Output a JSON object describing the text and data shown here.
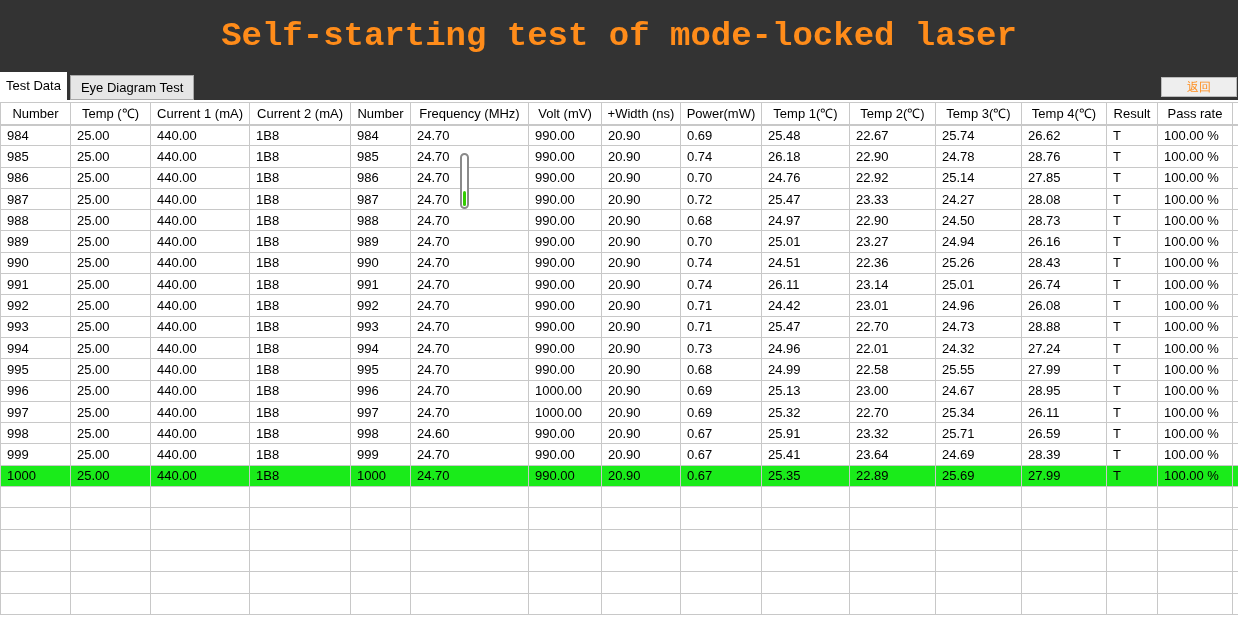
{
  "title": "Self-starting test of mode-locked laser",
  "tabs": [
    {
      "label": "Test Data",
      "selected": true
    },
    {
      "label": "Eye Diagram Test",
      "selected": false
    }
  ],
  "back_button": "返回",
  "table": {
    "columns": [
      "Number",
      "Temp (℃)",
      "Current 1 (mA)",
      "Current 2 (mA)",
      "Number",
      "Frequency (MHz)",
      "Volt (mV)",
      "+Width (ns)",
      "Power(mW)",
      "Temp 1(℃)",
      "Temp 2(℃)",
      "Temp 3(℃)",
      "Temp 4(℃)",
      "Result",
      "Pass rate"
    ],
    "rows": [
      {
        "selected": false,
        "cells": [
          "984",
          "25.00",
          "440.00",
          "1B8",
          "984",
          "24.70",
          "990.00",
          "20.90",
          "0.69",
          "25.48",
          "22.67",
          "25.74",
          "26.62",
          "T",
          "100.00 %"
        ]
      },
      {
        "selected": false,
        "cells": [
          "985",
          "25.00",
          "440.00",
          "1B8",
          "985",
          "24.70",
          "990.00",
          "20.90",
          "0.74",
          "26.18",
          "22.90",
          "24.78",
          "28.76",
          "T",
          "100.00 %"
        ]
      },
      {
        "selected": false,
        "cells": [
          "986",
          "25.00",
          "440.00",
          "1B8",
          "986",
          "24.70",
          "990.00",
          "20.90",
          "0.70",
          "24.76",
          "22.92",
          "25.14",
          "27.85",
          "T",
          "100.00 %"
        ]
      },
      {
        "selected": false,
        "cells": [
          "987",
          "25.00",
          "440.00",
          "1B8",
          "987",
          "24.70",
          "990.00",
          "20.90",
          "0.72",
          "25.47",
          "23.33",
          "24.27",
          "28.08",
          "T",
          "100.00 %"
        ]
      },
      {
        "selected": false,
        "cells": [
          "988",
          "25.00",
          "440.00",
          "1B8",
          "988",
          "24.70",
          "990.00",
          "20.90",
          "0.68",
          "24.97",
          "22.90",
          "24.50",
          "28.73",
          "T",
          "100.00 %"
        ]
      },
      {
        "selected": false,
        "cells": [
          "989",
          "25.00",
          "440.00",
          "1B8",
          "989",
          "24.70",
          "990.00",
          "20.90",
          "0.70",
          "25.01",
          "23.27",
          "24.94",
          "26.16",
          "T",
          "100.00 %"
        ]
      },
      {
        "selected": false,
        "cells": [
          "990",
          "25.00",
          "440.00",
          "1B8",
          "990",
          "24.70",
          "990.00",
          "20.90",
          "0.74",
          "24.51",
          "22.36",
          "25.26",
          "28.43",
          "T",
          "100.00 %"
        ]
      },
      {
        "selected": false,
        "cells": [
          "991",
          "25.00",
          "440.00",
          "1B8",
          "991",
          "24.70",
          "990.00",
          "20.90",
          "0.74",
          "26.11",
          "23.14",
          "25.01",
          "26.74",
          "T",
          "100.00 %"
        ]
      },
      {
        "selected": false,
        "cells": [
          "992",
          "25.00",
          "440.00",
          "1B8",
          "992",
          "24.70",
          "990.00",
          "20.90",
          "0.71",
          "24.42",
          "23.01",
          "24.96",
          "26.08",
          "T",
          "100.00 %"
        ]
      },
      {
        "selected": false,
        "cells": [
          "993",
          "25.00",
          "440.00",
          "1B8",
          "993",
          "24.70",
          "990.00",
          "20.90",
          "0.71",
          "25.47",
          "22.70",
          "24.73",
          "28.88",
          "T",
          "100.00 %"
        ]
      },
      {
        "selected": false,
        "cells": [
          "994",
          "25.00",
          "440.00",
          "1B8",
          "994",
          "24.70",
          "990.00",
          "20.90",
          "0.73",
          "24.96",
          "22.01",
          "24.32",
          "27.24",
          "T",
          "100.00 %"
        ]
      },
      {
        "selected": false,
        "cells": [
          "995",
          "25.00",
          "440.00",
          "1B8",
          "995",
          "24.70",
          "990.00",
          "20.90",
          "0.68",
          "24.99",
          "22.58",
          "25.55",
          "27.99",
          "T",
          "100.00 %"
        ]
      },
      {
        "selected": false,
        "cells": [
          "996",
          "25.00",
          "440.00",
          "1B8",
          "996",
          "24.70",
          "1000.00",
          "20.90",
          "0.69",
          "25.13",
          "23.00",
          "24.67",
          "28.95",
          "T",
          "100.00 %"
        ]
      },
      {
        "selected": false,
        "cells": [
          "997",
          "25.00",
          "440.00",
          "1B8",
          "997",
          "24.70",
          "1000.00",
          "20.90",
          "0.69",
          "25.32",
          "22.70",
          "25.34",
          "26.11",
          "T",
          "100.00 %"
        ]
      },
      {
        "selected": false,
        "cells": [
          "998",
          "25.00",
          "440.00",
          "1B8",
          "998",
          "24.60",
          "990.00",
          "20.90",
          "0.67",
          "25.91",
          "23.32",
          "25.71",
          "26.59",
          "T",
          "100.00 %"
        ]
      },
      {
        "selected": false,
        "cells": [
          "999",
          "25.00",
          "440.00",
          "1B8",
          "999",
          "24.70",
          "990.00",
          "20.90",
          "0.67",
          "25.41",
          "23.64",
          "24.69",
          "28.39",
          "T",
          "100.00 %"
        ]
      },
      {
        "selected": true,
        "cells": [
          "1000",
          "25.00",
          "440.00",
          "1B8",
          "1000",
          "24.70",
          "990.00",
          "20.90",
          "0.67",
          "25.35",
          "22.89",
          "25.69",
          "27.99",
          "T",
          "100.00 %"
        ]
      }
    ]
  },
  "progress": {
    "level": 0.3
  }
}
